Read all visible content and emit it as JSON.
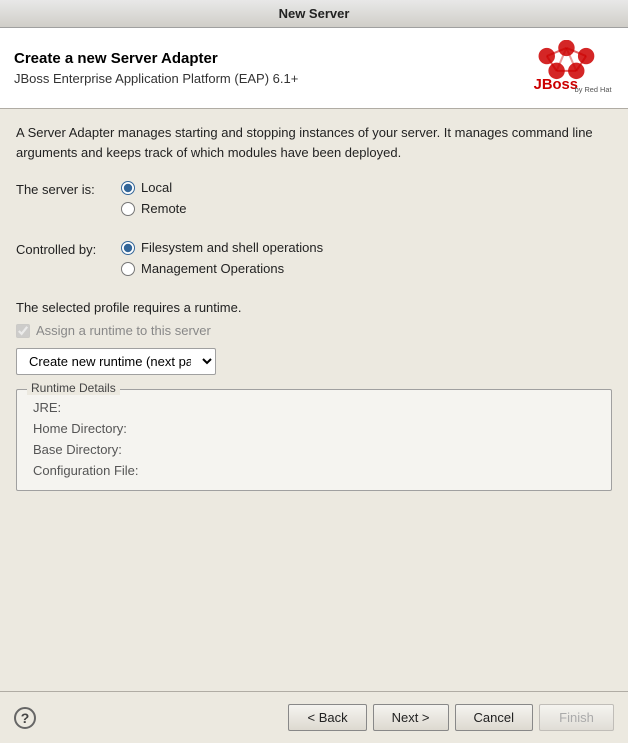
{
  "titleBar": {
    "title": "New Server"
  },
  "header": {
    "title": "Create a new Server Adapter",
    "subtitle": "JBoss Enterprise Application Platform (EAP) 6.1+"
  },
  "description": "A Server Adapter manages starting and stopping instances of your server. It manages command line arguments and keeps track of which modules have been deployed.",
  "serverIs": {
    "label": "The server is:",
    "options": [
      {
        "id": "local",
        "label": "Local",
        "checked": true
      },
      {
        "id": "remote",
        "label": "Remote",
        "checked": false
      }
    ]
  },
  "controlledBy": {
    "label": "Controlled by:",
    "options": [
      {
        "id": "filesystem",
        "label": "Filesystem and shell operations",
        "checked": true
      },
      {
        "id": "management",
        "label": "Management Operations",
        "checked": false
      }
    ]
  },
  "profileText": "The selected profile requires a runtime.",
  "assignCheckbox": {
    "label": "Assign a runtime to this server",
    "checked": true,
    "disabled": true
  },
  "dropdown": {
    "value": "Create new runtime (next page)",
    "options": [
      "Create new runtime (next page)"
    ]
  },
  "runtimeDetails": {
    "legend": "Runtime Details",
    "fields": [
      {
        "label": "JRE:",
        "value": ""
      },
      {
        "label": "Home Directory:",
        "value": ""
      },
      {
        "label": "Base Directory:",
        "value": ""
      },
      {
        "label": "Configuration File:",
        "value": ""
      }
    ]
  },
  "footer": {
    "helpIcon": "?",
    "buttons": {
      "back": "< Back",
      "next": "Next >",
      "cancel": "Cancel",
      "finish": "Finish"
    }
  }
}
